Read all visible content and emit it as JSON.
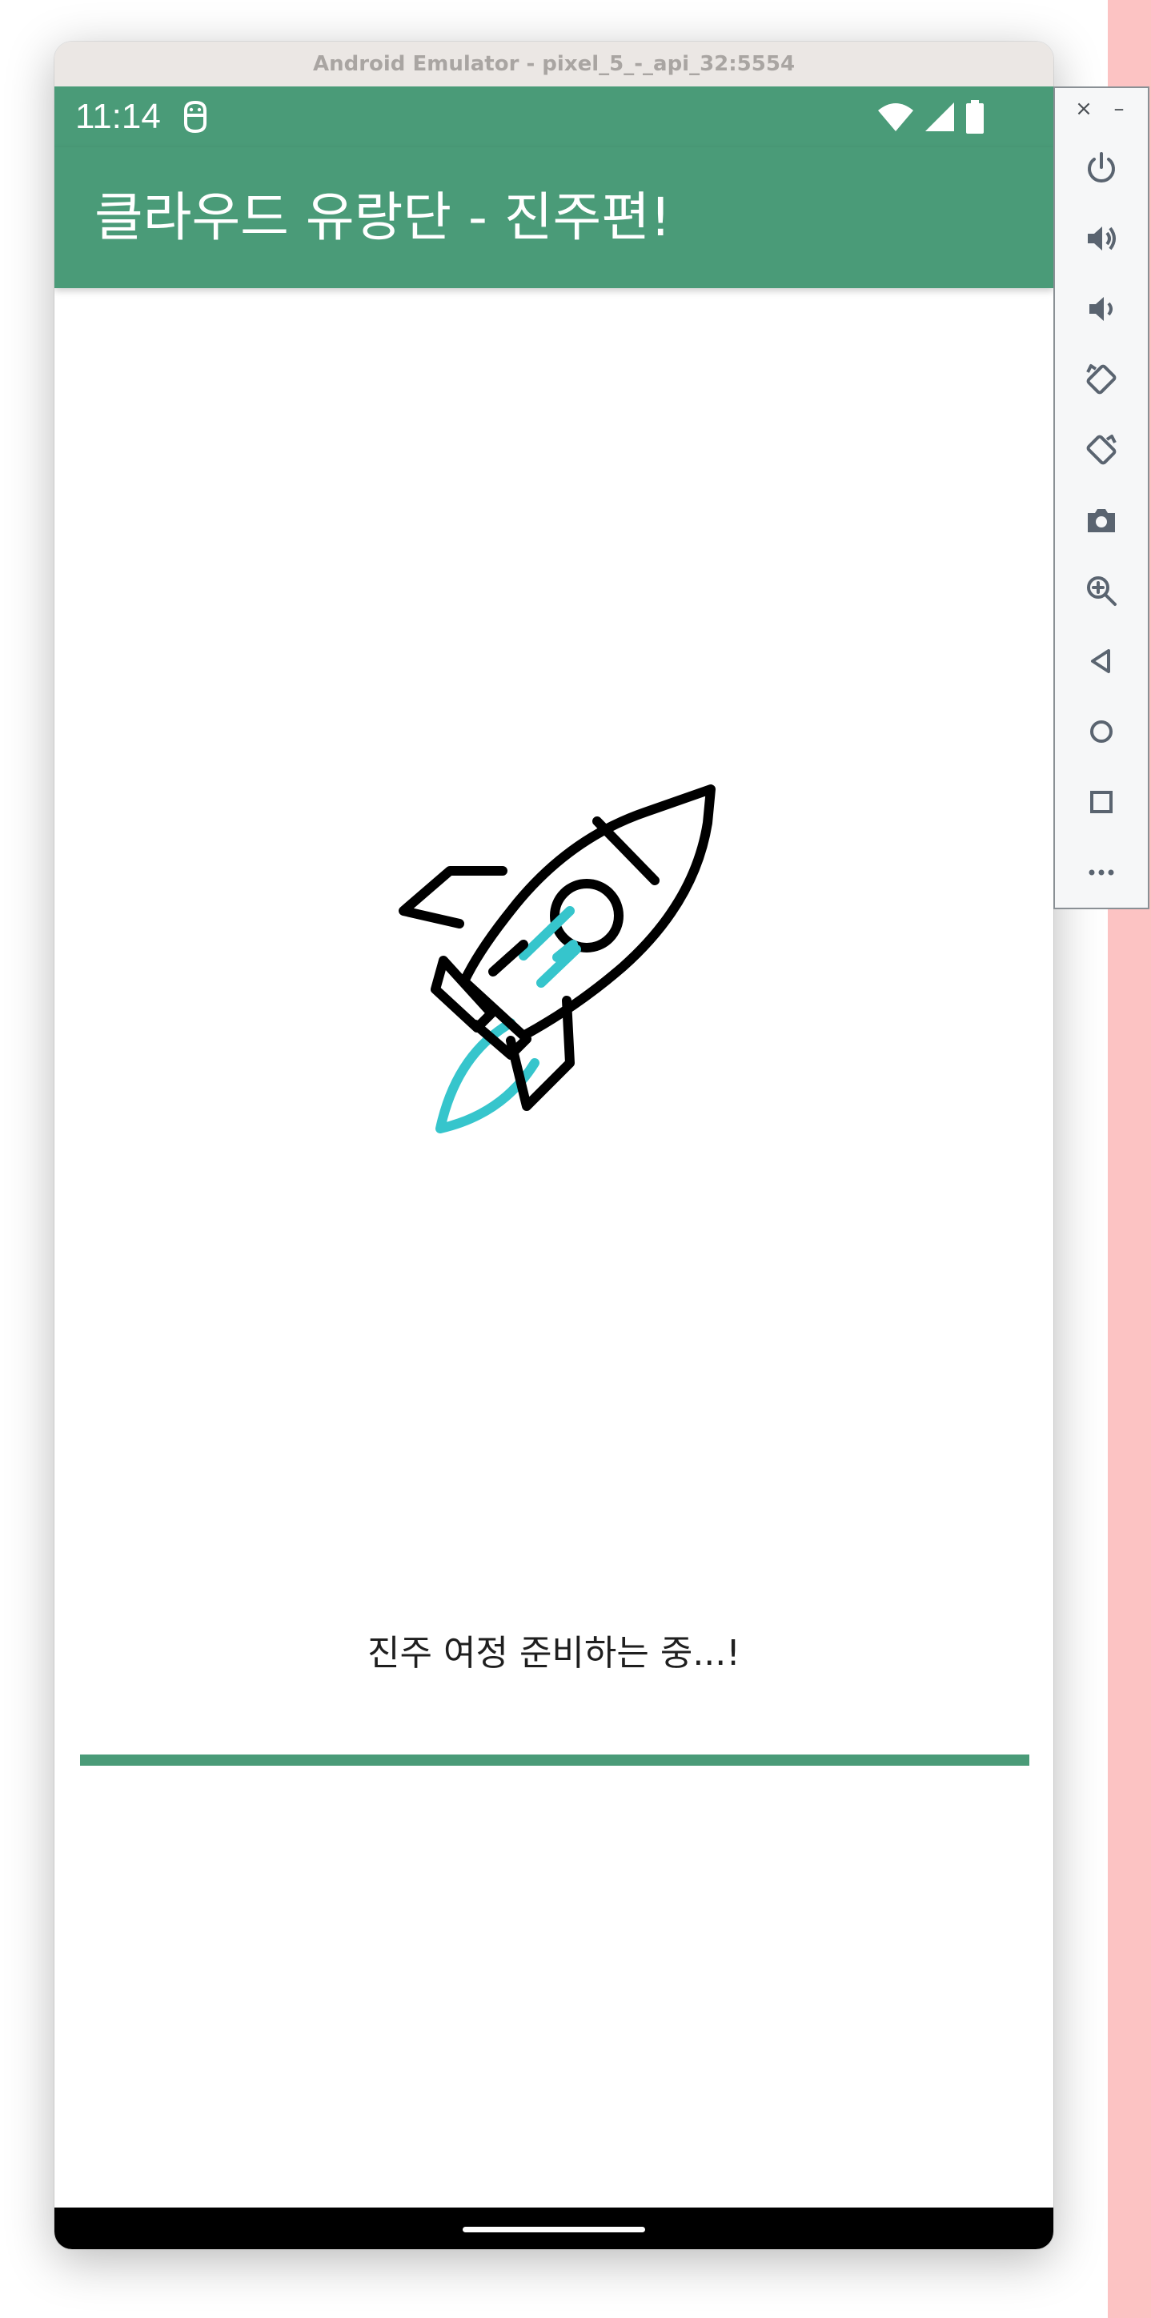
{
  "window": {
    "title": "Android Emulator - pixel_5_-_api_32:5554"
  },
  "status_bar": {
    "time": "11:14",
    "notification_icon": "android-debug-icon",
    "icons": [
      "wifi-icon",
      "cellular-signal-icon",
      "battery-icon"
    ]
  },
  "app_bar": {
    "title": "클라우드 유랑단 - 진주편!",
    "color": "#4a9b78"
  },
  "splash": {
    "illustration": "rocket-icon",
    "loading_text": "진주 여정 준비하는 중...!",
    "progress": 1.0,
    "accent_color": "#36c5cc"
  },
  "emulator_toolbar": {
    "window_controls": [
      "close-icon",
      "minimize-icon"
    ],
    "buttons": [
      "power-icon",
      "volume-up-icon",
      "volume-down-icon",
      "rotate-left-icon",
      "rotate-right-icon",
      "camera-icon",
      "zoom-icon",
      "back-icon",
      "home-icon",
      "overview-icon",
      "more-icon"
    ]
  }
}
